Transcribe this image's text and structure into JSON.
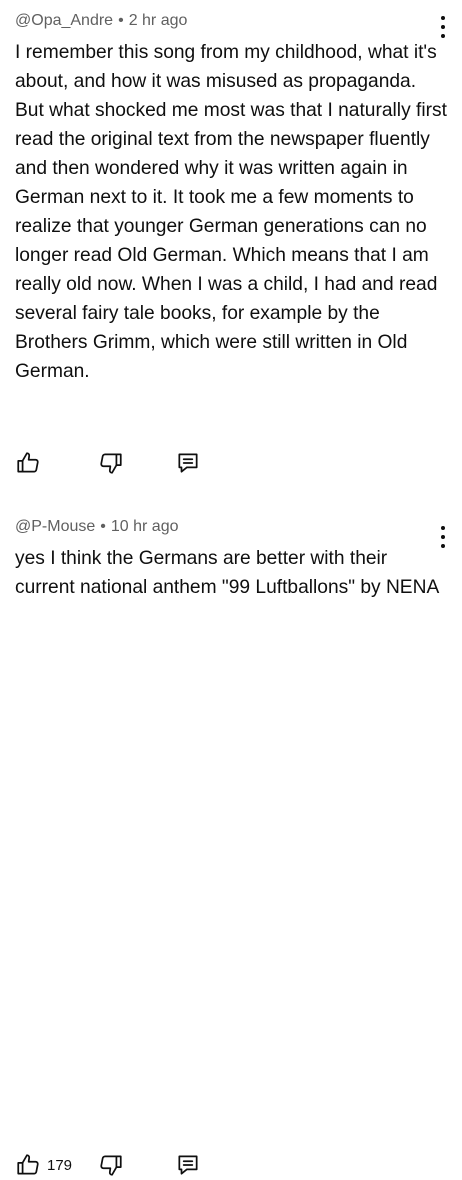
{
  "comments": [
    {
      "author": "@Opa_Andre",
      "separator": "•",
      "time": "2 hr ago",
      "text": "I remember this song from my childhood, what it's about, and how it was misused as propaganda. But what shocked me most was that I naturally first read the original text from the newspaper fluently and then wondered why it was written again in German next to it. It took me a few moments to realize that younger German generations can no longer read Old German. Which means that I am really old now. When I was a child, I had and read several fairy tale books, for example by the Brothers Grimm, which were still written in Old German.",
      "like_count": ""
    },
    {
      "author": "@P-Mouse",
      "separator": "•",
      "time": "10 hr ago",
      "text": "yes I think the Germans are better with their current national anthem \"99 Luftballons\" by NENA",
      "like_count": "179"
    }
  ],
  "icons": {
    "like": "thumbs-up-icon",
    "dislike": "thumbs-down-icon",
    "reply": "reply-comment-icon",
    "menu": "more-vertical-icon"
  },
  "colors": {
    "text": "#0f0f0f",
    "meta": "#606060",
    "background": "#ffffff"
  }
}
